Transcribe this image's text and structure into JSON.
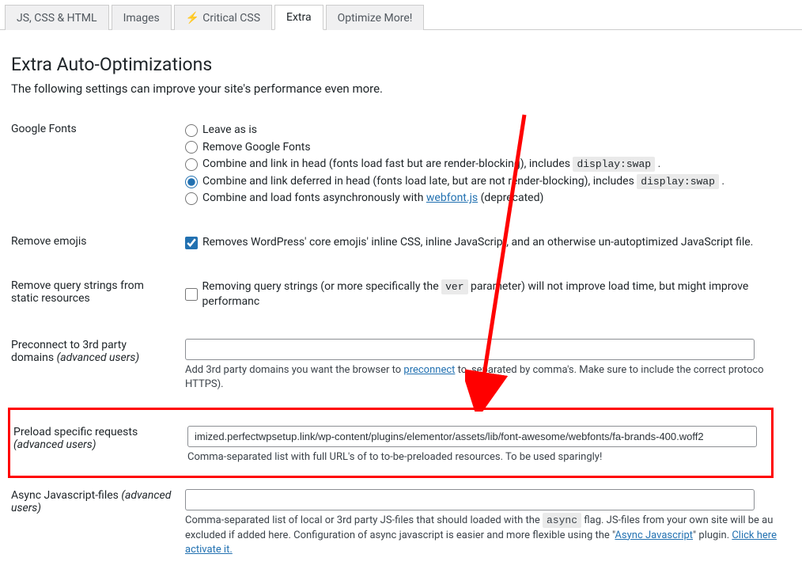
{
  "tabs": {
    "js_css_html": "JS, CSS & HTML",
    "images": "Images",
    "critical_css": "Critical CSS",
    "extra": "Extra",
    "optimize_more": "Optimize More!"
  },
  "page": {
    "title": "Extra Auto-Optimizations",
    "intro": "The following settings can improve your site's performance even more."
  },
  "google_fonts": {
    "label": "Google Fonts",
    "opt_leave": "Leave as is",
    "opt_remove": "Remove Google Fonts",
    "opt_combine_head_pre": "Combine and link in head (fonts load fast but are render-blocking), includes ",
    "opt_combine_head_code": "display:swap",
    "opt_combine_head_post": " .",
    "opt_deferred_pre": "Combine and link deferred in head (fonts load late, but are not render-blocking), includes ",
    "opt_deferred_code": "display:swap",
    "opt_deferred_post": " .",
    "opt_async_pre": "Combine and load fonts asynchronously with ",
    "opt_async_link": "webfont.js",
    "opt_async_post": " (deprecated)"
  },
  "remove_emojis": {
    "label": "Remove emojis",
    "text": "Removes WordPress' core emojis' inline CSS, inline JavaScript, and an otherwise un-autoptimized JavaScript file."
  },
  "query_strings": {
    "label_line1": "Remove query strings from",
    "label_line2": "static resources",
    "text_pre": "Removing query strings (or more specifically the ",
    "text_code": "ver",
    "text_post": " parameter) will not improve load time, but might improve performanc"
  },
  "preconnect": {
    "label_line1": "Preconnect to 3rd party",
    "label_line2": "domains",
    "label_suffix": " (advanced users)",
    "help_pre": "Add 3rd party domains you want the browser to ",
    "help_link": "preconnect",
    "help_post": " to, separated by comma's. Make sure to include the correct protoco",
    "help_line2": "HTTPS)."
  },
  "preload": {
    "label_line1": "Preload specific requests",
    "label_suffix": "(advanced users)",
    "value": "imized.perfectwpsetup.link/wp-content/plugins/elementor/assets/lib/font-awesome/webfonts/fa-brands-400.woff2",
    "help": "Comma-separated list with full URL's of to to-be-preloaded resources. To be used sparingly!"
  },
  "async_js": {
    "label_pre": "Async Javascript-files ",
    "label_suffix": "(advanced users)",
    "help_pre": "Comma-separated list of local or 3rd party JS-files that should loaded with the ",
    "help_code": "async",
    "help_mid": " flag. JS-files from your own site will be au",
    "help_line2_pre": "excluded if added here. Configuration of async javascript is easier and more flexible using the \"",
    "help_line2_link1": "Async Javascript",
    "help_line2_mid": "\" plugin. ",
    "help_line2_link2": "Click here",
    "help_line3_link": "activate it."
  }
}
